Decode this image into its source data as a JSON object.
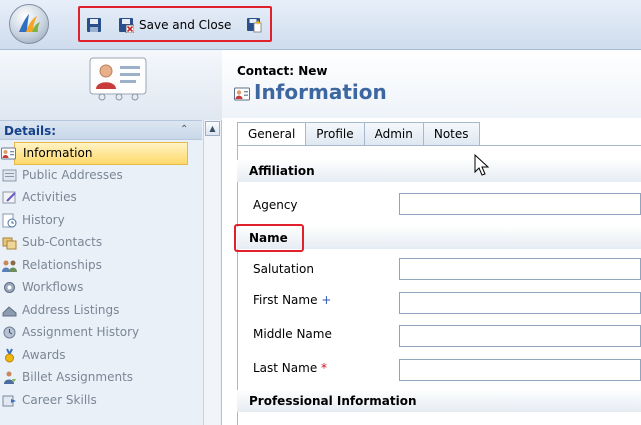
{
  "toolbar": {
    "save_and_close_label": "Save and Close"
  },
  "form": {
    "entity_label": "Contact: New",
    "title": "Information"
  },
  "sidebar": {
    "details_label": "Details:",
    "items": [
      {
        "label": "Information",
        "icon": "information-icon",
        "selected": true
      },
      {
        "label": "Public Addresses",
        "icon": "address-book-icon"
      },
      {
        "label": "Activities",
        "icon": "activities-icon"
      },
      {
        "label": "History",
        "icon": "history-icon"
      },
      {
        "label": "Sub-Contacts",
        "icon": "sub-contacts-icon"
      },
      {
        "label": "Relationships",
        "icon": "relationships-icon"
      },
      {
        "label": "Workflows",
        "icon": "workflows-icon"
      },
      {
        "label": "Address Listings",
        "icon": "address-listings-icon"
      },
      {
        "label": "Assignment History",
        "icon": "assignment-history-icon"
      },
      {
        "label": "Awards",
        "icon": "awards-icon"
      },
      {
        "label": "Billet Assignments",
        "icon": "billet-assignments-icon"
      },
      {
        "label": "Career Skills",
        "icon": "career-skills-icon"
      }
    ]
  },
  "tabs": [
    {
      "label": "General",
      "active": true
    },
    {
      "label": "Profile"
    },
    {
      "label": "Admin"
    },
    {
      "label": "Notes"
    }
  ],
  "sections": {
    "affiliation": "Affiliation",
    "name": "Name",
    "professional": "Professional Information"
  },
  "fields": {
    "agency": {
      "label": "Agency",
      "value": ""
    },
    "salutation": {
      "label": "Salutation",
      "value": ""
    },
    "first_name": {
      "label": "First Name",
      "marker": "+",
      "value": ""
    },
    "middle_name": {
      "label": "Middle Name",
      "value": ""
    },
    "last_name": {
      "label": "Last Name",
      "marker": "*",
      "value": ""
    }
  },
  "colors": {
    "highlight_red": "#e0202a",
    "title_blue": "#3d67a0",
    "required_red": "#d0131b",
    "recommended_blue": "#2a59b5"
  }
}
